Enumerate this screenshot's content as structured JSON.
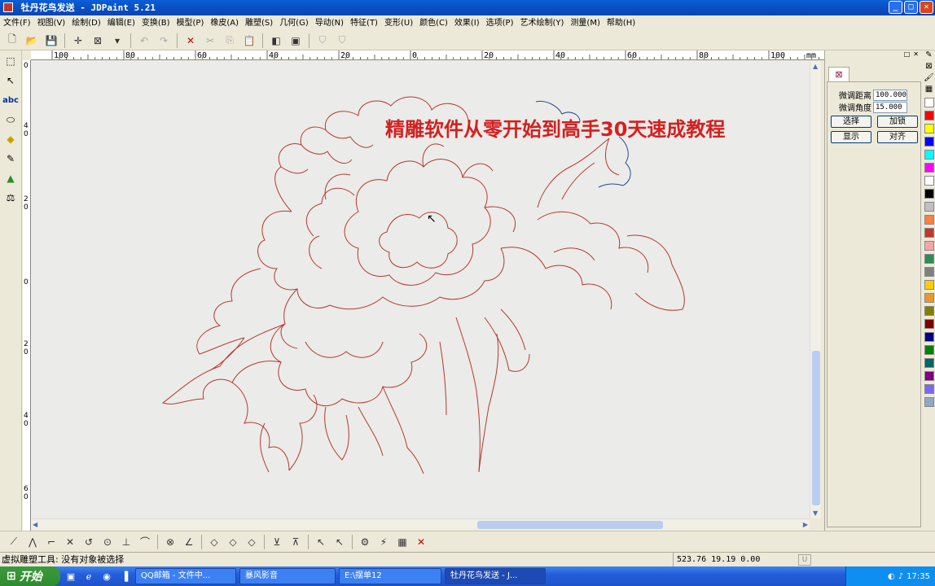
{
  "window": {
    "title": "牡丹花鸟发送 - JDPaint 5.21"
  },
  "menu": [
    "文件(F)",
    "视图(V)",
    "绘制(D)",
    "编辑(E)",
    "变换(B)",
    "模型(P)",
    "橡皮(A)",
    "雕塑(S)",
    "几何(G)",
    "导动(N)",
    "特征(T)",
    "变形(U)",
    "颜色(C)",
    "效果(I)",
    "选项(P)",
    "艺术绘制(Y)",
    "测量(M)",
    "帮助(H)"
  ],
  "ruler": {
    "unit": "mm",
    "top_labels": [
      "100",
      "80",
      "60",
      "40",
      "20",
      "0",
      "20",
      "40",
      "60",
      "80",
      "100"
    ],
    "left_labels": [
      "0",
      "4\n0",
      "2\n0",
      "0",
      "2\n0",
      "4\n0",
      "6\n0"
    ]
  },
  "canvas": {
    "heading": "精雕软件从零开始到高手30天速成教程"
  },
  "panel": {
    "fine_distance_label": "微调距离",
    "fine_distance_value": "100.000",
    "fine_angle_label": "微调角度",
    "fine_angle_value": "15.000",
    "select_button": "选择",
    "lock_button": "加锁",
    "show_button": "显示",
    "align_button": "对齐"
  },
  "palette_colors": [
    "#ffffff",
    "#ff0000",
    "#ffff00",
    "#0000ff",
    "#00ffff",
    "#ff00ff",
    "#ffffff",
    "#000000",
    "#c0c0c0",
    "#ff8040",
    "#c0392b",
    "#f4a6a6",
    "#2e8b57",
    "#808080",
    "#ffcc00",
    "#e69a2e",
    "#808000",
    "#800000",
    "#000080",
    "#008000",
    "#006666",
    "#800080",
    "#7b68ee",
    "#8fa8c8"
  ],
  "status": {
    "message": "虚拟雕塑工具: 没有对象被选择",
    "coords": "523.76 19.19 0.00",
    "unit_box": "U"
  },
  "taskbar": {
    "start": "开始",
    "tasks": [
      "QQ邮箱 - 文件中...",
      "暴风影音",
      "E:\\摆单12",
      "牡丹花鸟发送 - J..."
    ],
    "clock": "17:35"
  }
}
